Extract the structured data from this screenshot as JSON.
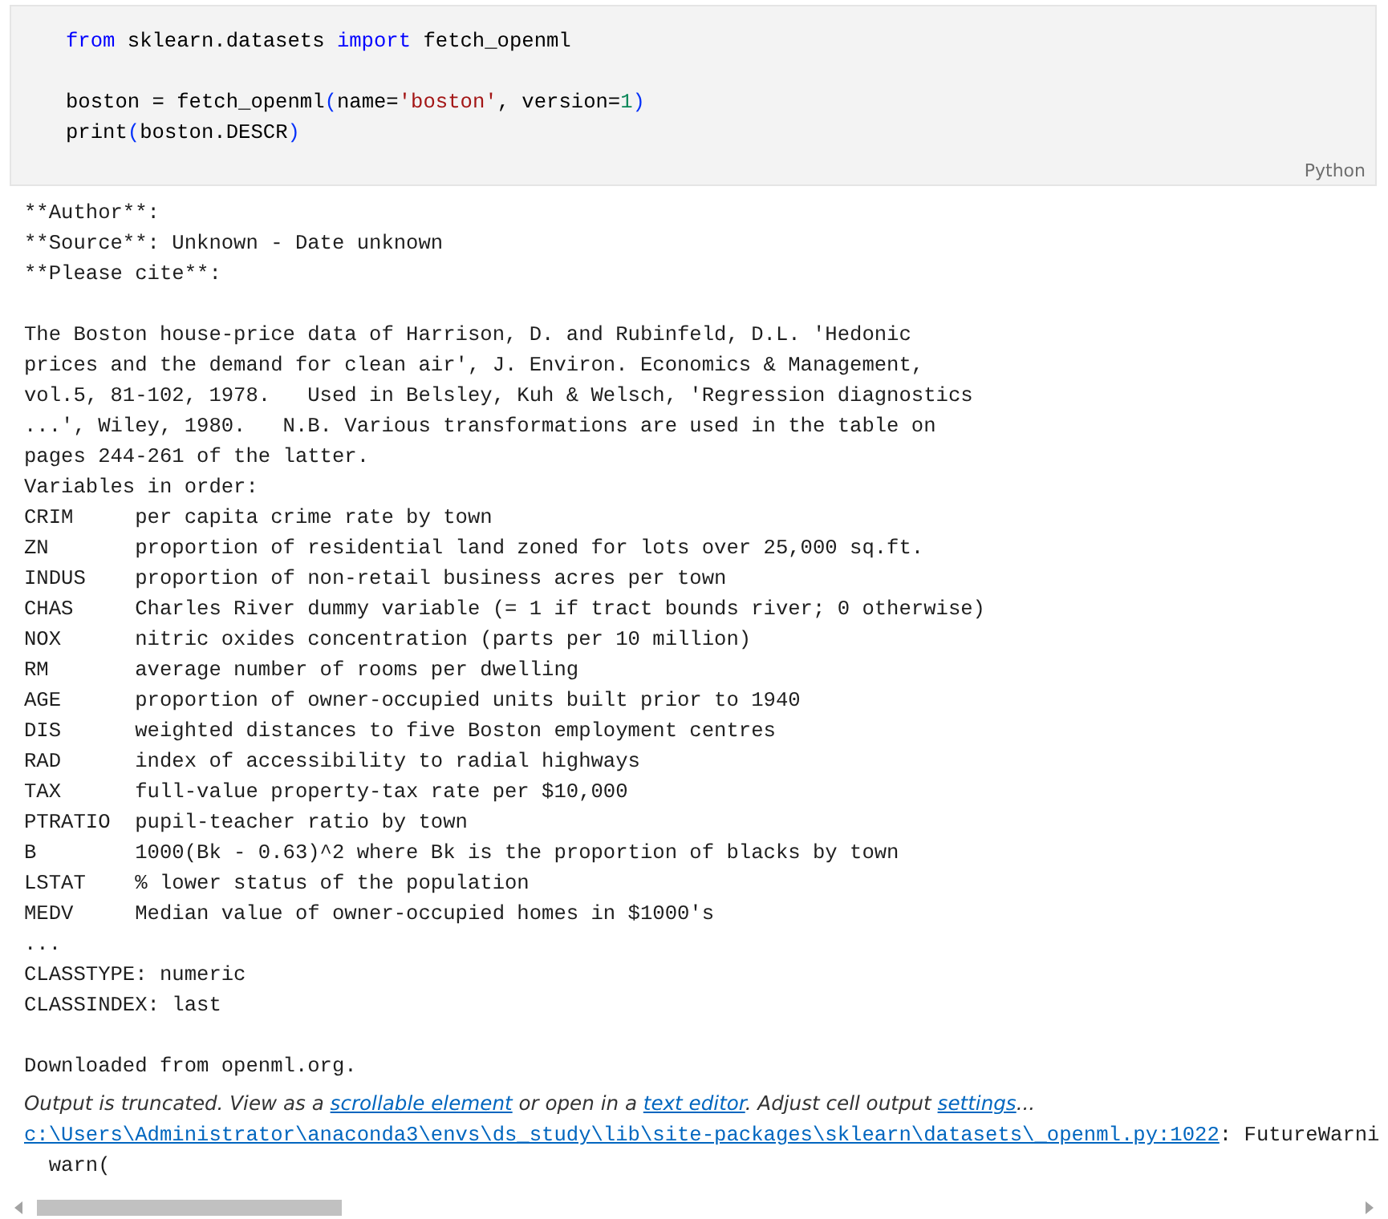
{
  "code_cell": {
    "language": "Python",
    "blocks": [
      [
        [
          {
            "kind": "keyword",
            "text": "from"
          },
          {
            "kind": "plain",
            "text": " sklearn.datasets "
          },
          {
            "kind": "keyword",
            "text": "import"
          },
          {
            "kind": "plain",
            "text": " fetch_openml"
          }
        ]
      ],
      [
        [
          {
            "kind": "plain",
            "text": "boston = fetch_openml"
          },
          {
            "kind": "paren",
            "text": "("
          },
          {
            "kind": "plain",
            "text": "name="
          },
          {
            "kind": "string",
            "text": "'boston'"
          },
          {
            "kind": "plain",
            "text": ", version="
          },
          {
            "kind": "number",
            "text": "1"
          },
          {
            "kind": "paren",
            "text": ")"
          }
        ],
        [
          {
            "kind": "plain",
            "text": "print"
          },
          {
            "kind": "paren",
            "text": "("
          },
          {
            "kind": "plain",
            "text": "boston.DESCR"
          },
          {
            "kind": "paren",
            "text": ")"
          }
        ]
      ]
    ]
  },
  "output": {
    "blocks": [
      [
        "**Author**:",
        "**Source**: Unknown - Date unknown",
        "**Please cite**:"
      ],
      [
        "The Boston house-price data of Harrison, D. and Rubinfeld, D.L. 'Hedonic",
        "prices and the demand for clean air', J. Environ. Economics & Management,",
        "vol.5, 81-102, 1978.   Used in Belsley, Kuh & Welsch, 'Regression diagnostics",
        "...', Wiley, 1980.   N.B. Various transformations are used in the table on",
        "pages 244-261 of the latter.",
        "Variables in order:",
        "CRIM     per capita crime rate by town",
        "ZN       proportion of residential land zoned for lots over 25,000 sq.ft.",
        "INDUS    proportion of non-retail business acres per town",
        "CHAS     Charles River dummy variable (= 1 if tract bounds river; 0 otherwise)",
        "NOX      nitric oxides concentration (parts per 10 million)",
        "RM       average number of rooms per dwelling",
        "AGE      proportion of owner-occupied units built prior to 1940",
        "DIS      weighted distances to five Boston employment centres",
        "RAD      index of accessibility to radial highways",
        "TAX      full-value property-tax rate per $10,000",
        "PTRATIO  pupil-teacher ratio by town",
        "B        1000(Bk - 0.63)^2 where Bk is the proportion of blacks by town",
        "LSTAT    % lower status of the population",
        "MEDV     Median value of owner-occupied homes in $1000's",
        "...",
        "CLASSTYPE: numeric",
        "CLASSINDEX: last"
      ],
      [
        "Downloaded from openml.org."
      ]
    ],
    "truncation_notice": [
      {
        "kind": "text",
        "text": "Output is truncated. View as a "
      },
      {
        "kind": "link",
        "text": "scrollable element"
      },
      {
        "kind": "text",
        "text": " or open in a "
      },
      {
        "kind": "link",
        "text": "text editor"
      },
      {
        "kind": "text",
        "text": ". Adjust cell output "
      },
      {
        "kind": "link",
        "text": "settings"
      },
      {
        "kind": "text",
        "text": "..."
      }
    ],
    "warning": {
      "path": "c:\\Users\\Administrator\\anaconda3\\envs\\ds_study\\lib\\site-packages\\sklearn\\datasets\\_openml.py:1022",
      "message": ": FutureWarni"
    },
    "warn_line": "  warn("
  }
}
